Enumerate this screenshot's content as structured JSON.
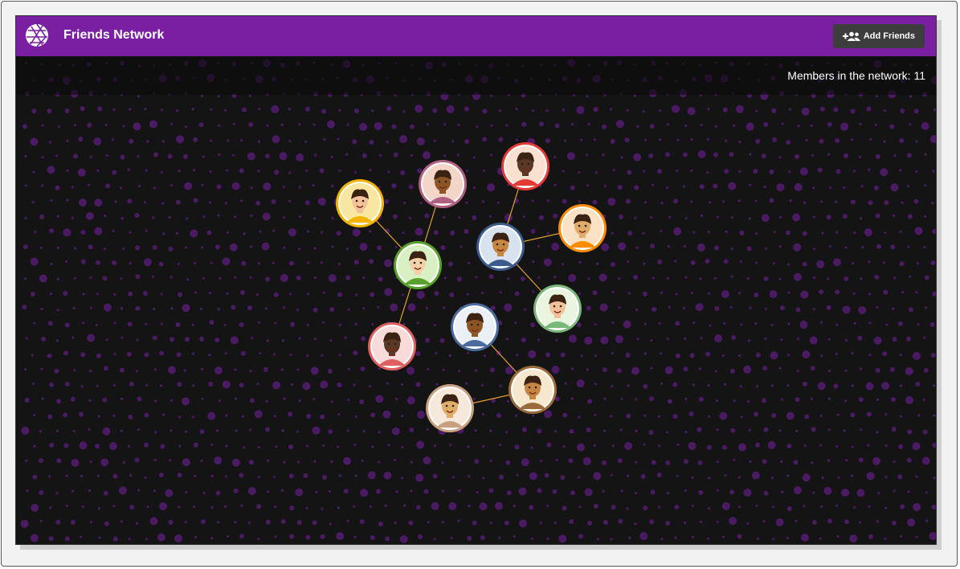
{
  "header": {
    "title": "Friends Network",
    "brand_color": "#7b1fa2",
    "logo_icon": "geometric-sphere-logo",
    "add_button": {
      "label": "Add Friends",
      "icon": "add-people-icon"
    }
  },
  "status": {
    "members_text": "Members in the network: 11",
    "members_count": 11
  },
  "theme": {
    "background": "#141414",
    "dot_color": "#4a1a63",
    "edge_color": "#e0a030"
  },
  "members": [
    {
      "id": "m1",
      "avatar": "woman-red-hair-sunglasses-avatar",
      "ring_color": "#f4b400",
      "bg": "#f7e7a0"
    },
    {
      "id": "m2",
      "avatar": "man-beard-red-shirt-avatar",
      "ring_color": "#b06080",
      "bg": "#f3d6c8"
    },
    {
      "id": "m3",
      "avatar": "woman-afro-headband-avatar",
      "ring_color": "#e53935",
      "bg": "#f9e0d0"
    },
    {
      "id": "m4",
      "avatar": "man-glasses-vest-avatar",
      "ring_color": "#3b5b8b",
      "bg": "#d9e3f0"
    },
    {
      "id": "m5",
      "avatar": "woman-curly-hair-avatar",
      "ring_color": "#ff8c00",
      "bg": "#fbe2c4"
    },
    {
      "id": "m6",
      "avatar": "woman-pink-hair-overalls-avatar",
      "ring_color": "#5aa02c",
      "bg": "#d9f0c4"
    },
    {
      "id": "m7",
      "avatar": "man-red-hair-smiling-avatar",
      "ring_color": "#7ab87a",
      "bg": "#eaf5e0"
    },
    {
      "id": "m8",
      "avatar": "man-dark-hair-avatar",
      "ring_color": "#4a6b9b",
      "bg": "#eaf0f5"
    },
    {
      "id": "m9",
      "avatar": "person-curly-green-avatar",
      "ring_color": "#e06060",
      "bg": "#f8dada"
    },
    {
      "id": "m10",
      "avatar": "man-red-hair-yellow-avatar",
      "ring_color": "#9b6b3b",
      "bg": "#f5e8cf"
    },
    {
      "id": "m11",
      "avatar": "woman-headband-avatar",
      "ring_color": "#c8a080",
      "bg": "#f7e8dc"
    }
  ],
  "connections": [
    [
      "m1",
      "m6"
    ],
    [
      "m2",
      "m6"
    ],
    [
      "m6",
      "m9"
    ],
    [
      "m3",
      "m4"
    ],
    [
      "m4",
      "m5"
    ],
    [
      "m4",
      "m7"
    ],
    [
      "m8",
      "m10"
    ],
    [
      "m10",
      "m11"
    ]
  ]
}
